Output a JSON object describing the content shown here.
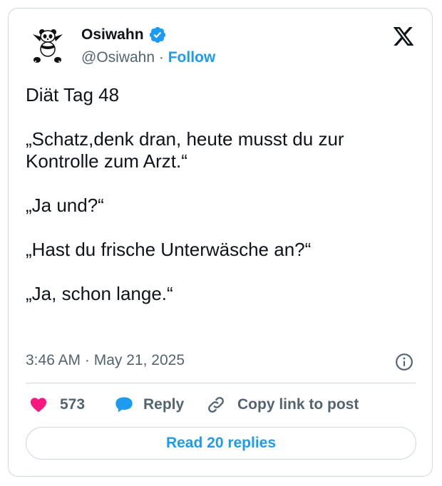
{
  "author": {
    "name": "Osiwahn",
    "handle": "@Osiwahn",
    "separator": "·",
    "follow_label": "Follow",
    "avatar_icon": "panda-avatar",
    "verified_icon": "verified-badge-icon"
  },
  "platform_icon": "x-logo-icon",
  "tweet": {
    "lines": [
      "Diät Tag 48",
      "„Schatz,denk dran, heute musst du zur",
      "Kontrolle zum Arzt.“",
      "„Ja und?“",
      "„Hast du frische Unterwäsche an?“",
      "„Ja, schon lange.“"
    ]
  },
  "meta": {
    "time": "3:46 AM",
    "separator": "·",
    "date": "May 21, 2025",
    "info_icon": "info-icon"
  },
  "actions": {
    "like_count": "573",
    "like_icon": "heart-icon",
    "reply_label": "Reply",
    "reply_icon": "speech-bubble-icon",
    "copy_label": "Copy link to post",
    "copy_icon": "link-icon"
  },
  "read_replies_label": "Read 20 replies",
  "colors": {
    "accent": "#1d9bf0",
    "like": "#f91880",
    "text": "#0f1419",
    "muted": "#536471",
    "border": "#cfd9de"
  }
}
